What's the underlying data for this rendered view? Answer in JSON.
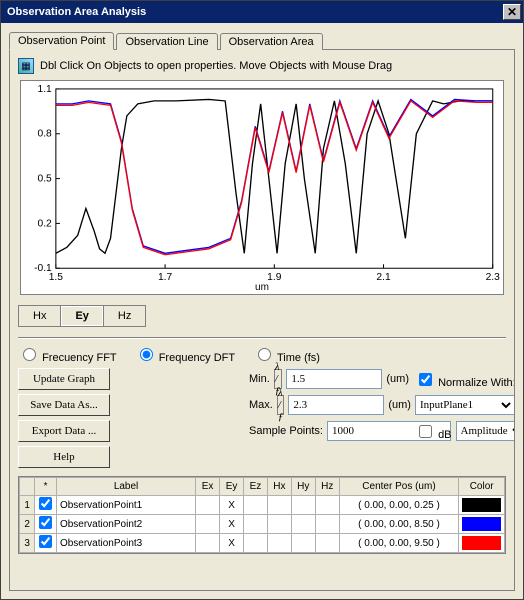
{
  "window": {
    "title": "Observation Area Analysis"
  },
  "tabs": [
    {
      "label": "Observation Point",
      "active": true
    },
    {
      "label": "Observation Line",
      "active": false
    },
    {
      "label": "Observation Area",
      "active": false
    }
  ],
  "hint": "Dbl Click On Objects to open properties.  Move Objects with Mouse Drag",
  "field_tabs": [
    {
      "label": "Hx",
      "active": false
    },
    {
      "label": "Ey",
      "active": true
    },
    {
      "label": "Hz",
      "active": false
    }
  ],
  "modes": {
    "fft": "Frecuency FFT",
    "dft": "Frequency DFT",
    "time": "Time (fs)",
    "selected": "dft"
  },
  "range": {
    "min_label": "Min.",
    "max_label": "Max.",
    "lambda_label": "λ / ƒ",
    "unit": "(um)",
    "min": "1.5",
    "max": "2.3",
    "sample_label": "Sample Points:",
    "sample": "1000"
  },
  "normalize": {
    "label": "Normalize With:",
    "checked": true,
    "source": "InputPlane1",
    "db_label": "dB",
    "db_checked": false,
    "type": "Amplitude"
  },
  "buttons": {
    "update": "Update Graph",
    "save": "Save Data As...",
    "export": "Export Data ...",
    "help": "Help"
  },
  "table": {
    "headers": [
      "",
      "*",
      "Label",
      "Ex",
      "Ey",
      "Ez",
      "Hx",
      "Hy",
      "Hz",
      "Center Pos (um)",
      "Color"
    ],
    "rows": [
      {
        "idx": "1",
        "on": true,
        "label": "ObservationPoint1",
        "ey": "X",
        "pos": "( 0.00, 0.00, 0.25 )",
        "color": "#000000"
      },
      {
        "idx": "2",
        "on": true,
        "label": "ObservationPoint2",
        "ey": "X",
        "pos": "( 0.00, 0.00, 8.50 )",
        "color": "#0000ff"
      },
      {
        "idx": "3",
        "on": true,
        "label": "ObservationPoint3",
        "ey": "X",
        "pos": "( 0.00, 0.00, 9.50 )",
        "color": "#ff0000"
      }
    ]
  },
  "chart_data": {
    "type": "line",
    "xlabel": "um",
    "ylabel": "",
    "xlim": [
      1.5,
      2.3
    ],
    "ylim": [
      -0.1,
      1.1
    ],
    "xticks": [
      1.5,
      1.7,
      1.9,
      2.1,
      2.3
    ],
    "yticks": [
      -0.1,
      0.2,
      0.5,
      0.8,
      1.1
    ],
    "series": [
      {
        "name": "ObservationPoint1",
        "color": "#000000",
        "x": [
          1.5,
          1.52,
          1.54,
          1.555,
          1.57,
          1.58,
          1.59,
          1.6,
          1.61,
          1.62,
          1.63,
          1.65,
          1.68,
          1.72,
          1.78,
          1.81,
          1.83,
          1.845,
          1.86,
          1.875,
          1.89,
          1.905,
          1.92,
          1.94,
          1.955,
          1.975,
          1.99,
          2.01,
          2.03,
          2.05,
          2.07,
          2.09,
          2.11,
          2.14,
          2.16,
          2.19,
          2.21,
          2.24,
          2.27,
          2.3
        ],
        "y": [
          0.0,
          0.04,
          0.12,
          0.3,
          0.15,
          0.03,
          0.0,
          0.1,
          0.4,
          0.7,
          0.92,
          1.0,
          1.02,
          1.02,
          1.03,
          1.02,
          0.4,
          0.0,
          0.6,
          1.0,
          0.5,
          0.0,
          0.6,
          1.0,
          0.5,
          0.0,
          0.7,
          1.02,
          0.6,
          0.0,
          0.8,
          1.02,
          0.8,
          0.1,
          0.8,
          1.02,
          1.0,
          1.02,
          1.02,
          1.02
        ]
      },
      {
        "name": "ObservationPoint2",
        "color": "#0000ff",
        "x": [
          1.5,
          1.53,
          1.56,
          1.58,
          1.6,
          1.62,
          1.64,
          1.66,
          1.7,
          1.74,
          1.78,
          1.82,
          1.84,
          1.865,
          1.89,
          1.915,
          1.94,
          1.965,
          1.99,
          2.02,
          2.05,
          2.08,
          2.11,
          2.15,
          2.19,
          2.23,
          2.27,
          2.3
        ],
        "y": [
          1.0,
          1.0,
          1.02,
          1.01,
          1.0,
          0.75,
          0.3,
          0.05,
          0.0,
          0.02,
          0.04,
          0.1,
          0.35,
          0.85,
          0.55,
          0.95,
          0.55,
          1.0,
          0.62,
          1.02,
          0.7,
          1.02,
          0.78,
          1.03,
          0.92,
          1.03,
          1.02,
          1.02
        ]
      },
      {
        "name": "ObservationPoint3",
        "color": "#ff0000",
        "x": [
          1.5,
          1.53,
          1.56,
          1.58,
          1.6,
          1.62,
          1.64,
          1.66,
          1.7,
          1.74,
          1.78,
          1.82,
          1.84,
          1.865,
          1.89,
          1.915,
          1.94,
          1.965,
          1.99,
          2.02,
          2.05,
          2.08,
          2.11,
          2.15,
          2.19,
          2.23,
          2.27,
          2.3
        ],
        "y": [
          0.99,
          0.99,
          1.01,
          1.0,
          0.99,
          0.74,
          0.29,
          0.04,
          -0.01,
          0.01,
          0.03,
          0.09,
          0.34,
          0.84,
          0.54,
          0.94,
          0.54,
          0.99,
          0.61,
          1.01,
          0.69,
          1.01,
          0.77,
          1.02,
          0.91,
          1.02,
          1.01,
          1.01
        ]
      }
    ]
  }
}
